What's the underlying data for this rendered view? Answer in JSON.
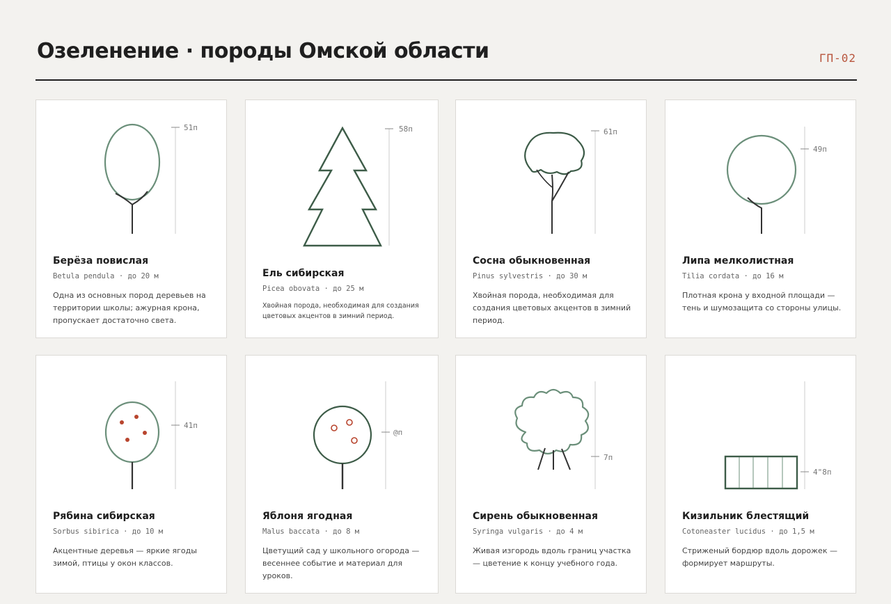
{
  "header": {
    "title": "Озеленение · породы Омской области",
    "code": "ГП-02"
  },
  "colors": {
    "foliage": "#6b8f7a",
    "trunk": "#333333",
    "conifer": "#3d5c48",
    "berry": "#b8452e",
    "code": "#b8553d"
  },
  "cards": [
    {
      "icon": "birch-tree-icon",
      "name": "Берёза повислая",
      "latin": "Betula pendula",
      "height": "до 20 м",
      "height_label": "51п",
      "description": "Одна из основных пород деревьев на территории школы; ажурная крона, пропускает достаточно света."
    },
    {
      "icon": "spruce-tree-icon",
      "name": "Ель сибирская",
      "latin": "Picea obovata",
      "height": "до 25 м",
      "height_label": "58п",
      "description": "Хвойная порода, необходимая для создания цветовых акцентов в зимний период."
    },
    {
      "icon": "pine-tree-icon",
      "name": "Сосна обыкновенная",
      "latin": "Pinus sylvestris",
      "height": "до 30 м",
      "height_label": "61п",
      "description": "Хвойная порода, необходимая для создания цветовых акцентов в зимний период."
    },
    {
      "icon": "linden-tree-icon",
      "name": "Липа мелколистная",
      "latin": "Tilia cordata",
      "height": "до 16 м",
      "height_label": "49п",
      "description": "Плотная крона у входной площади — тень и шумозащита со стороны улицы."
    },
    {
      "icon": "rowan-tree-icon",
      "name": "Рябина сибирская",
      "latin": "Sorbus sibirica",
      "height": "до 10 м",
      "height_label": "41п",
      "description": "Акцентные деревья — яркие ягоды зимой, птицы у окон классов."
    },
    {
      "icon": "apple-tree-icon",
      "name": "Яблоня ягодная",
      "latin": "Malus baccata",
      "height": "до 8 м",
      "height_label": "@п",
      "description": "Цветущий сад у школьного огорода — весеннее событие и материал для уроков."
    },
    {
      "icon": "lilac-shrub-icon",
      "name": "Сирень обыкновенная",
      "latin": "Syringa vulgaris",
      "height": "до 4 м",
      "height_label": "7п",
      "description": "Живая изгородь вдоль границ участка — цветение к концу учебного года."
    },
    {
      "icon": "cotoneaster-hedge-icon",
      "name": "Кизильник блестящий",
      "latin": "Cotoneaster lucidus",
      "height": "до 1,5 м",
      "height_label": "4\"8п",
      "description": "Стриженый бордюр вдоль дорожек — формирует маршруты."
    }
  ]
}
